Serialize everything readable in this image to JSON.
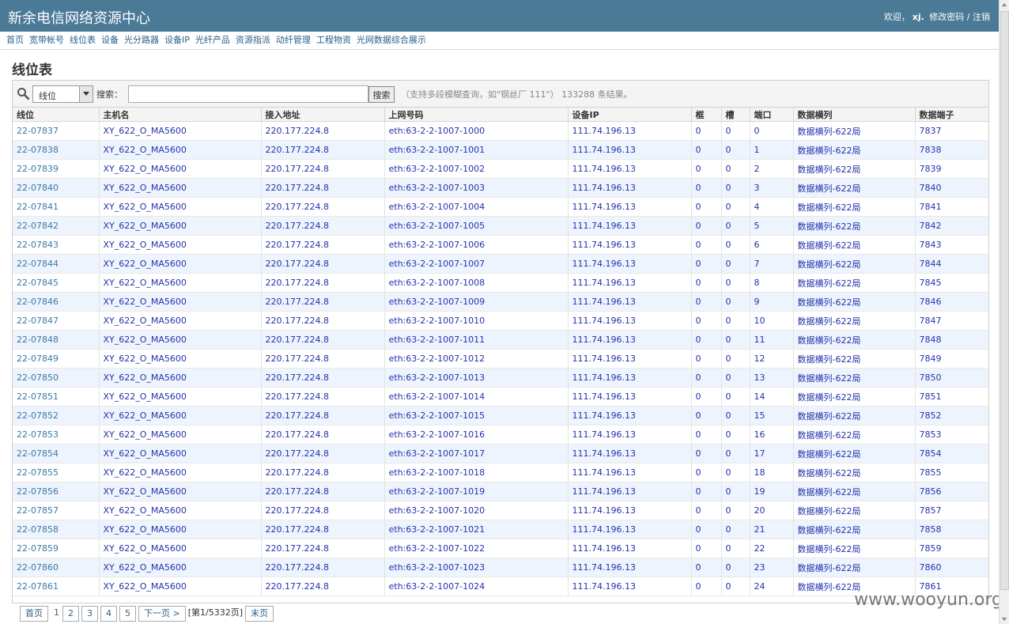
{
  "header": {
    "title": "新余电信网络资源中心",
    "welcome": "欢迎，",
    "username": "xj.",
    "change_password": "修改密码",
    "separator": "/",
    "logout": "注销"
  },
  "nav": [
    "首页",
    "宽带帐号",
    "线位表",
    "设备",
    "光分路器",
    "设备IP",
    "光纤产品",
    "资源指派",
    "动纤管理",
    "工程物资",
    "光网数据综合展示"
  ],
  "page_title": "线位表",
  "search": {
    "field_value": "线位",
    "label": "搜索：",
    "input_value": "",
    "button": "搜索",
    "hint": "（支持多段模糊查询，如\"钢丝厂 111\"） 133288 条结果。"
  },
  "table": {
    "headers": [
      "线位",
      "主机名",
      "接入地址",
      "上网号码",
      "设备IP",
      "框",
      "槽",
      "端口",
      "数据横列",
      "数据端子"
    ],
    "rows": [
      [
        "22-07837",
        "XY_622_O_MA5600",
        "220.177.224.8",
        "eth:63-2-2-1007-1000",
        "111.74.196.13",
        "0",
        "0",
        "0",
        "数据横列-622局",
        "7837"
      ],
      [
        "22-07838",
        "XY_622_O_MA5600",
        "220.177.224.8",
        "eth:63-2-2-1007-1001",
        "111.74.196.13",
        "0",
        "0",
        "1",
        "数据横列-622局",
        "7838"
      ],
      [
        "22-07839",
        "XY_622_O_MA5600",
        "220.177.224.8",
        "eth:63-2-2-1007-1002",
        "111.74.196.13",
        "0",
        "0",
        "2",
        "数据横列-622局",
        "7839"
      ],
      [
        "22-07840",
        "XY_622_O_MA5600",
        "220.177.224.8",
        "eth:63-2-2-1007-1003",
        "111.74.196.13",
        "0",
        "0",
        "3",
        "数据横列-622局",
        "7840"
      ],
      [
        "22-07841",
        "XY_622_O_MA5600",
        "220.177.224.8",
        "eth:63-2-2-1007-1004",
        "111.74.196.13",
        "0",
        "0",
        "4",
        "数据横列-622局",
        "7841"
      ],
      [
        "22-07842",
        "XY_622_O_MA5600",
        "220.177.224.8",
        "eth:63-2-2-1007-1005",
        "111.74.196.13",
        "0",
        "0",
        "5",
        "数据横列-622局",
        "7842"
      ],
      [
        "22-07843",
        "XY_622_O_MA5600",
        "220.177.224.8",
        "eth:63-2-2-1007-1006",
        "111.74.196.13",
        "0",
        "0",
        "6",
        "数据横列-622局",
        "7843"
      ],
      [
        "22-07844",
        "XY_622_O_MA5600",
        "220.177.224.8",
        "eth:63-2-2-1007-1007",
        "111.74.196.13",
        "0",
        "0",
        "7",
        "数据横列-622局",
        "7844"
      ],
      [
        "22-07845",
        "XY_622_O_MA5600",
        "220.177.224.8",
        "eth:63-2-2-1007-1008",
        "111.74.196.13",
        "0",
        "0",
        "8",
        "数据横列-622局",
        "7845"
      ],
      [
        "22-07846",
        "XY_622_O_MA5600",
        "220.177.224.8",
        "eth:63-2-2-1007-1009",
        "111.74.196.13",
        "0",
        "0",
        "9",
        "数据横列-622局",
        "7846"
      ],
      [
        "22-07847",
        "XY_622_O_MA5600",
        "220.177.224.8",
        "eth:63-2-2-1007-1010",
        "111.74.196.13",
        "0",
        "0",
        "10",
        "数据横列-622局",
        "7847"
      ],
      [
        "22-07848",
        "XY_622_O_MA5600",
        "220.177.224.8",
        "eth:63-2-2-1007-1011",
        "111.74.196.13",
        "0",
        "0",
        "11",
        "数据横列-622局",
        "7848"
      ],
      [
        "22-07849",
        "XY_622_O_MA5600",
        "220.177.224.8",
        "eth:63-2-2-1007-1012",
        "111.74.196.13",
        "0",
        "0",
        "12",
        "数据横列-622局",
        "7849"
      ],
      [
        "22-07850",
        "XY_622_O_MA5600",
        "220.177.224.8",
        "eth:63-2-2-1007-1013",
        "111.74.196.13",
        "0",
        "0",
        "13",
        "数据横列-622局",
        "7850"
      ],
      [
        "22-07851",
        "XY_622_O_MA5600",
        "220.177.224.8",
        "eth:63-2-2-1007-1014",
        "111.74.196.13",
        "0",
        "0",
        "14",
        "数据横列-622局",
        "7851"
      ],
      [
        "22-07852",
        "XY_622_O_MA5600",
        "220.177.224.8",
        "eth:63-2-2-1007-1015",
        "111.74.196.13",
        "0",
        "0",
        "15",
        "数据横列-622局",
        "7852"
      ],
      [
        "22-07853",
        "XY_622_O_MA5600",
        "220.177.224.8",
        "eth:63-2-2-1007-1016",
        "111.74.196.13",
        "0",
        "0",
        "16",
        "数据横列-622局",
        "7853"
      ],
      [
        "22-07854",
        "XY_622_O_MA5600",
        "220.177.224.8",
        "eth:63-2-2-1007-1017",
        "111.74.196.13",
        "0",
        "0",
        "17",
        "数据横列-622局",
        "7854"
      ],
      [
        "22-07855",
        "XY_622_O_MA5600",
        "220.177.224.8",
        "eth:63-2-2-1007-1018",
        "111.74.196.13",
        "0",
        "0",
        "18",
        "数据横列-622局",
        "7855"
      ],
      [
        "22-07856",
        "XY_622_O_MA5600",
        "220.177.224.8",
        "eth:63-2-2-1007-1019",
        "111.74.196.13",
        "0",
        "0",
        "19",
        "数据横列-622局",
        "7856"
      ],
      [
        "22-07857",
        "XY_622_O_MA5600",
        "220.177.224.8",
        "eth:63-2-2-1007-1020",
        "111.74.196.13",
        "0",
        "0",
        "20",
        "数据横列-622局",
        "7857"
      ],
      [
        "22-07858",
        "XY_622_O_MA5600",
        "220.177.224.8",
        "eth:63-2-2-1007-1021",
        "111.74.196.13",
        "0",
        "0",
        "21",
        "数据横列-622局",
        "7858"
      ],
      [
        "22-07859",
        "XY_622_O_MA5600",
        "220.177.224.8",
        "eth:63-2-2-1007-1022",
        "111.74.196.13",
        "0",
        "0",
        "22",
        "数据横列-622局",
        "7859"
      ],
      [
        "22-07860",
        "XY_622_O_MA5600",
        "220.177.224.8",
        "eth:63-2-2-1007-1023",
        "111.74.196.13",
        "0",
        "0",
        "23",
        "数据横列-622局",
        "7860"
      ],
      [
        "22-07861",
        "XY_622_O_MA5600",
        "220.177.224.8",
        "eth:63-2-2-1007-1024",
        "111.74.196.13",
        "0",
        "0",
        "24",
        "数据横列-622局",
        "7861"
      ]
    ]
  },
  "pager": {
    "first": "首页",
    "current": "1",
    "pages": [
      "2",
      "3",
      "4",
      "5"
    ],
    "next": "下一页 >",
    "info": "[第1/5332页]",
    "last": "末页"
  },
  "watermark": "www.wooyun.org",
  "icons": {
    "search": "search-icon",
    "dropdown": "chevron-down-icon"
  },
  "colors": {
    "header_bg": "#4a7a96",
    "link": "#2233aa",
    "row_alt": "#eef4fd"
  }
}
